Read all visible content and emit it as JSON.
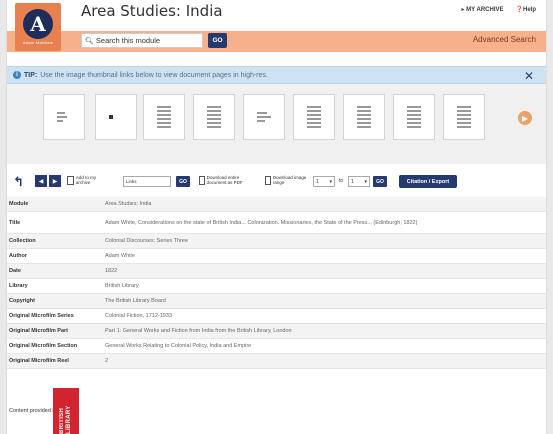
{
  "header": {
    "title": "Area Studies: India",
    "logo_letter": "A",
    "logo_text": "Adam Matthew",
    "my_archive": "MY ARCHIVE",
    "help": "Help",
    "search_placeholder": "Search this module",
    "go": "GO",
    "advanced_search": "Advanced Search"
  },
  "tip": {
    "label": "TIP:",
    "text": "Use the image thumbnail links below to view document pages in high-res."
  },
  "toolbar": {
    "add_archive": "Add to my archive",
    "page_input": "Links",
    "go": "GO",
    "download_pdf": "Download entire document as PDF",
    "download_range": "Download image range",
    "range_from": "1",
    "to": "to",
    "range_to": "1",
    "go2": "GO",
    "citation": "Citation / Export"
  },
  "metadata": [
    {
      "label": "Module",
      "value": "Area Studies: India"
    },
    {
      "label": "Title",
      "value": "Adam White, Considerations on the state of British India... Colonization. Missionaries, the State of the Press... (Edinburgh, 1822)"
    },
    {
      "label": "Collection",
      "value": "Colonial Discourses: Series Three"
    },
    {
      "label": "Author",
      "value": "Adam White"
    },
    {
      "label": "Date",
      "value": "1822"
    },
    {
      "label": "Library",
      "value": "British Library"
    },
    {
      "label": "Copyright",
      "value": "The British Library Board"
    },
    {
      "label": "Original Microfilm Series",
      "value": "Colonial Fiction, 1712-1933"
    },
    {
      "label": "Original Microfilm Part",
      "value": "Part 1: General Works and Fiction from India from the British Library, London"
    },
    {
      "label": "Original Microfilm Section",
      "value": "General Works Relating to Colonial Policy, India and Empire"
    },
    {
      "label": "Original Microfilm Reel",
      "value": "2"
    }
  ],
  "footer": {
    "content_provided": "Content provided by",
    "bl_logo_text": "BRITISH LIBRARY"
  },
  "colors": {
    "brand_orange": "#e8814f",
    "navy": "#263a6e",
    "tip_blue": "#cde3f3",
    "bl_red": "#d1242e"
  }
}
